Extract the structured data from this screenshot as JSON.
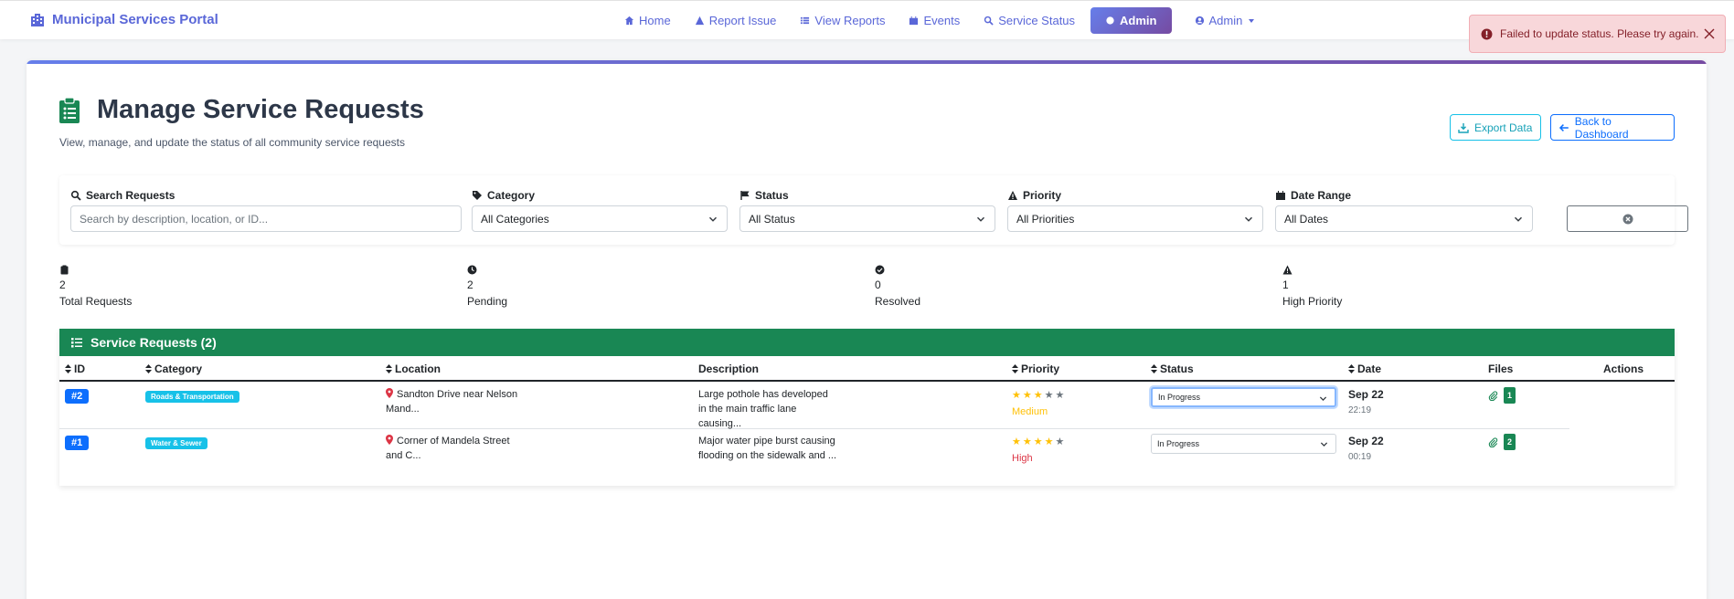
{
  "navbar": {
    "brand": "Municipal Services Portal",
    "links": [
      {
        "label": "Home",
        "icon": "home-icon"
      },
      {
        "label": "Report Issue",
        "icon": "warning-icon"
      },
      {
        "label": "View Reports",
        "icon": "list-icon"
      },
      {
        "label": "Events",
        "icon": "calendar-icon"
      },
      {
        "label": "Service Status",
        "icon": "search-icon"
      },
      {
        "label": "Admin",
        "icon": "gear-icon",
        "active": true
      },
      {
        "label": "Admin",
        "icon": "user-icon",
        "dropdown": true
      }
    ]
  },
  "toast": {
    "message": "Failed to update status. Please try again."
  },
  "page": {
    "title": "Manage Service Requests",
    "subtitle": "View, manage, and update the status of all community service requests",
    "export_label": "Export Data",
    "back_label": "Back to Dashboard"
  },
  "filters": {
    "search": {
      "label": "Search Requests",
      "placeholder": "Search by description, location, or ID..."
    },
    "category": {
      "label": "Category",
      "value": "All Categories"
    },
    "status": {
      "label": "Status",
      "value": "All Status"
    },
    "priority": {
      "label": "Priority",
      "value": "All Priorities"
    },
    "date": {
      "label": "Date Range",
      "value": "All Dates"
    }
  },
  "stats": [
    {
      "value": "2",
      "label": "Total Requests",
      "icon": "clipboard-icon"
    },
    {
      "value": "2",
      "label": "Pending",
      "icon": "clock-icon"
    },
    {
      "value": "0",
      "label": "Resolved",
      "icon": "check-circle-icon"
    },
    {
      "value": "1",
      "label": "High Priority",
      "icon": "warning-icon"
    }
  ],
  "table": {
    "title": "Service Requests (2)",
    "headers": {
      "id": "ID",
      "category": "Category",
      "location": "Location",
      "description": "Description",
      "priority": "Priority",
      "status": "Status",
      "date": "Date",
      "files": "Files",
      "actions": "Actions"
    },
    "rows": [
      {
        "id": "#2",
        "category": "Roads & Transportation",
        "location_1": "Sandton Drive near Nelson",
        "location_2": "Mand...",
        "desc_1": "Large pothole has developed",
        "desc_2": "in the main traffic lane",
        "desc_3": "causing...",
        "stars": 3,
        "priority": "Medium",
        "status": "In Progress",
        "date": "Sep 22",
        "time": "22:19",
        "files": "1"
      },
      {
        "id": "#1",
        "category": "Water & Sewer",
        "location_1": "Corner of Mandela Street",
        "location_2": "and C...",
        "desc_1": "Major water pipe burst causing",
        "desc_2": "flooding on the sidewalk and ...",
        "stars": 4,
        "priority": "High",
        "status": "In Progress",
        "date": "Sep 22",
        "time": "00:19",
        "files": "2"
      }
    ]
  }
}
